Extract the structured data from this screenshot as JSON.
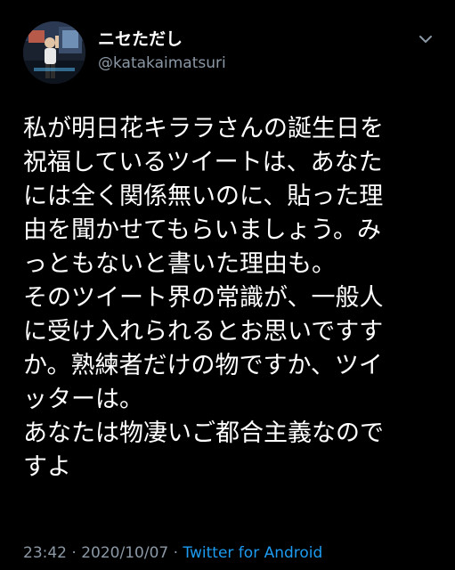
{
  "colors": {
    "background": "#000000",
    "text": "#ffffff",
    "secondary": "#8b98a5",
    "link": "#1d9bf0"
  },
  "author": {
    "display_name": "ニセただし",
    "handle": "@katakaimatsuri",
    "avatar_icon": "profile-photo"
  },
  "menu": {
    "icon": "chevron-down-icon"
  },
  "tweet": {
    "text": "私が明日花キララさんの誕生日を\n祝福しているツイートは、あなた\nには全く関係無いのに、貼った理\n由を聞かせてもらいましょう。み\nっともないと書いた理由も。\nそのツイート界の常識が、一般人\nに受け入れられるとお思いですす\nか。熟練者だけの物ですか、ツイ\nッターは。\nあなたは物凄いご都合主義なので\nすよ"
  },
  "footer": {
    "time": "23:42",
    "separator1": " · ",
    "date": "2020/10/07",
    "separator2": " · ",
    "source": "Twitter for Android"
  }
}
